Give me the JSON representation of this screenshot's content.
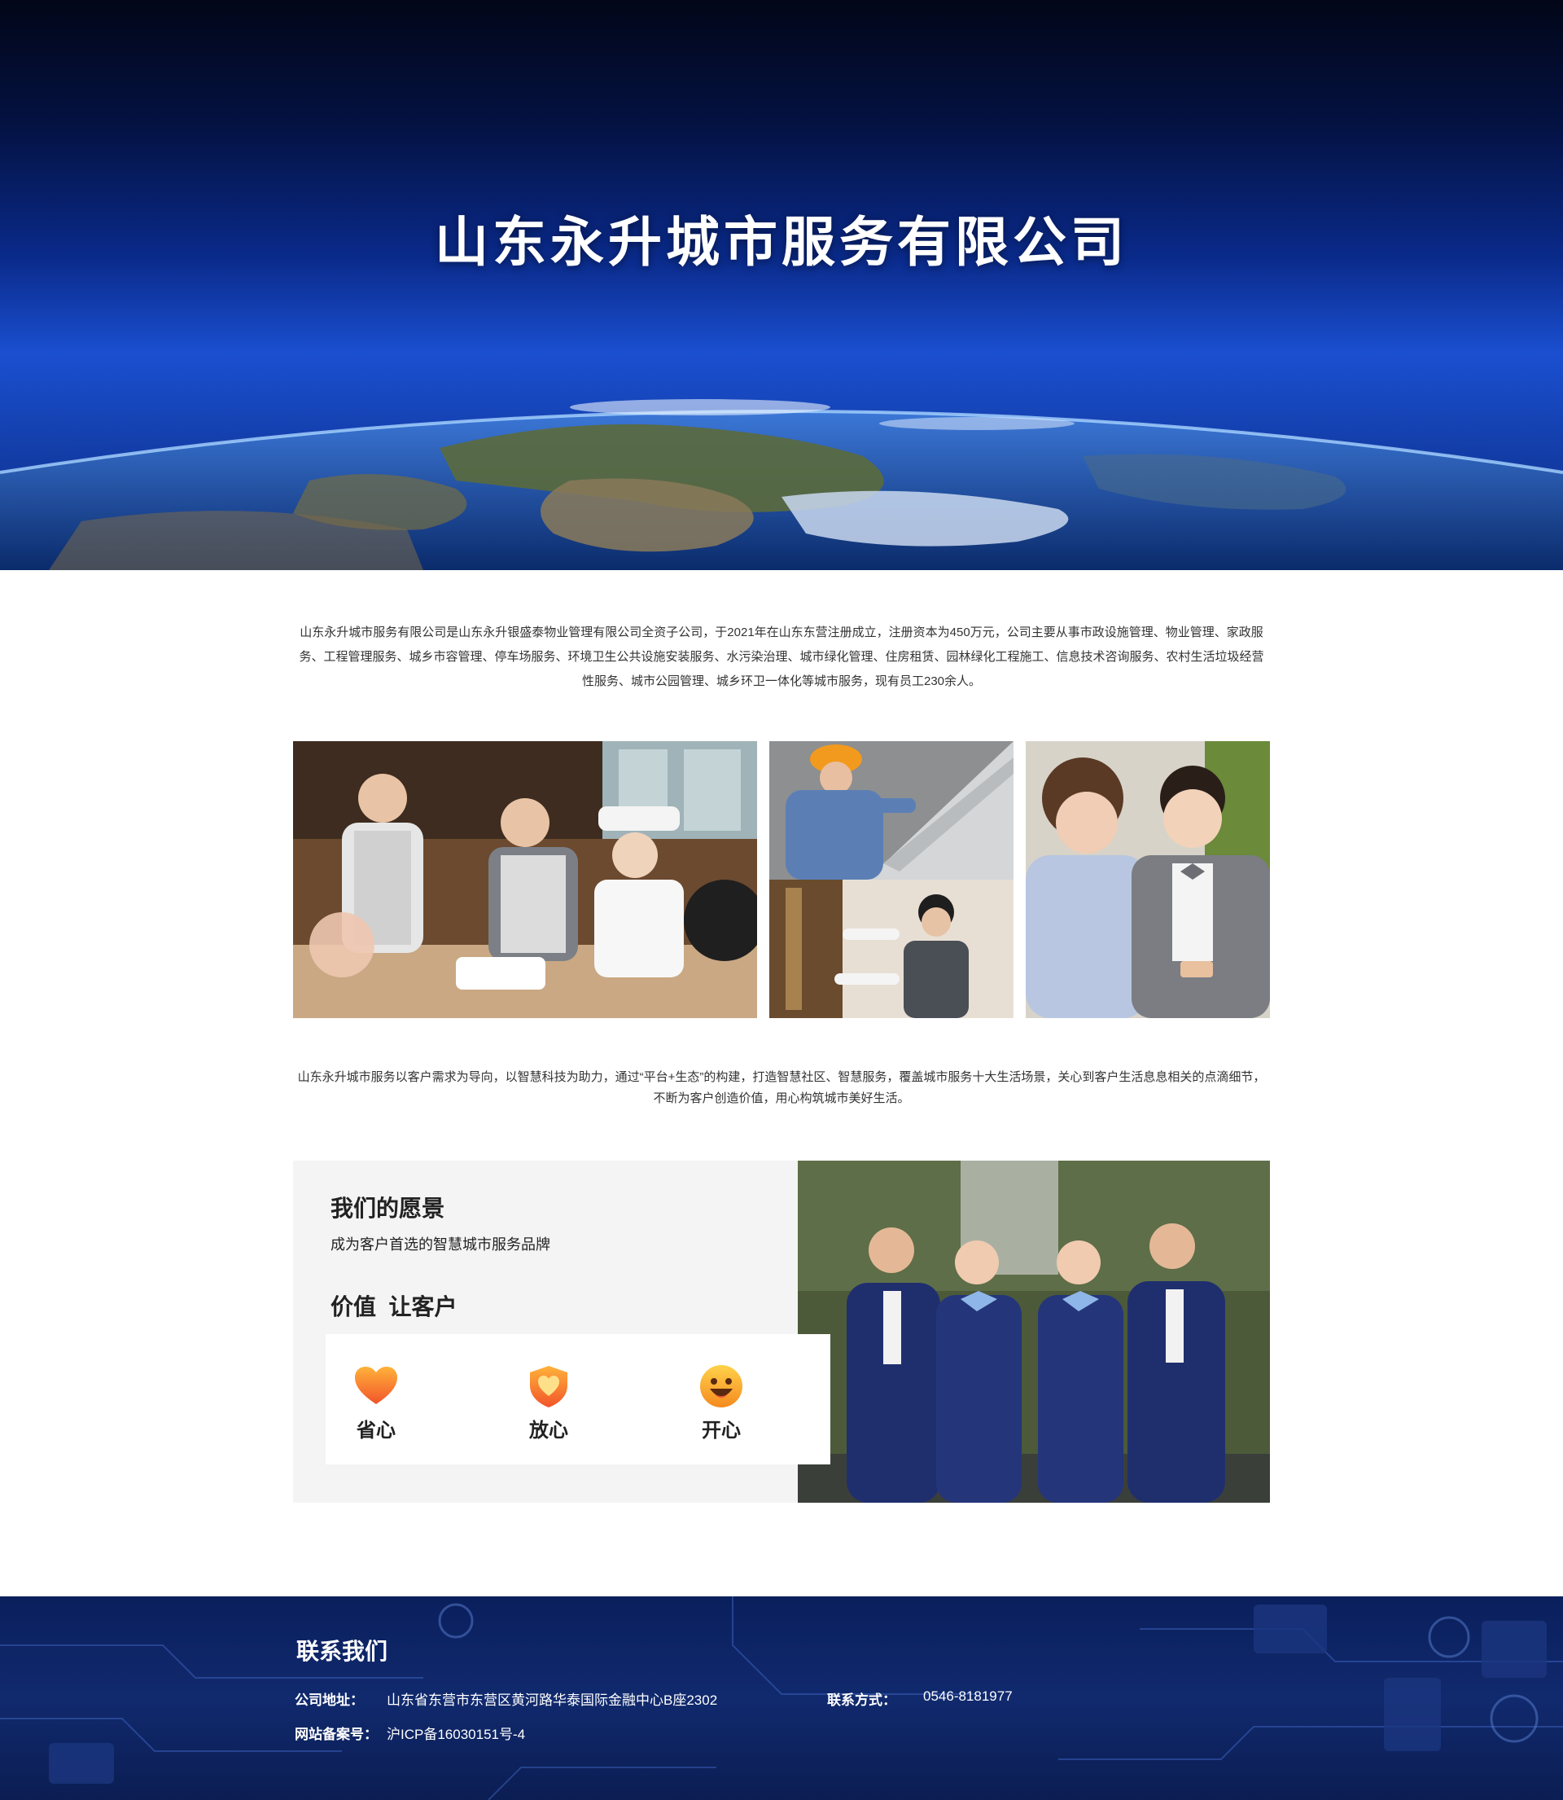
{
  "hero": {
    "title": "山东永升城市服务有限公司"
  },
  "intro": {
    "text": "山东永升城市服务有限公司是山东永升银盛泰物业管理有限公司全资子公司，于2021年在山东东营注册成立，注册资本为450万元，公司主要从事市政设施管理、物业管理、家政服务、工程管理服务、城乡市容管理、停车场服务、环境卫生公共设施安装服务、水污染治理、城市绿化管理、住房租赁、园林绿化工程施工、信息技术咨询服务、农村生活垃圾经营性服务、城市公园管理、城乡环卫一体化等城市服务，现有员工230余人。"
  },
  "mission": {
    "text": "山东永升城市服务以客户需求为导向，以智慧科技为助力，通过“平台+生态”的构建，打造智慧社区、智慧服务，覆盖城市服务十大生活场景，关心到客户生活息息相关的点滴细节，不断为客户创造价值，用心构筑城市美好生活。"
  },
  "vision": {
    "title": "我们的愿景",
    "subtitle": "成为客户首选的智慧城市服务品牌",
    "value_title": "价值  让客户",
    "values": [
      {
        "label": "省心",
        "icon": "heart-icon"
      },
      {
        "label": "放心",
        "icon": "shield-heart-icon"
      },
      {
        "label": "开心",
        "icon": "smile-icon"
      }
    ]
  },
  "footer": {
    "title": "联系我们",
    "address_label": "公司地址：",
    "address_value": "山东省东营市东营区黄河路华泰国际金融中心B座2302",
    "contact_label": "联系方式：",
    "contact_value": "0546-8181977",
    "icp_label": "网站备案号：",
    "icp_value": "沪ICP备16030151号-4"
  },
  "colors": {
    "accent_orange": "#f26a2e",
    "footer_blue": "#0a1f5c"
  }
}
